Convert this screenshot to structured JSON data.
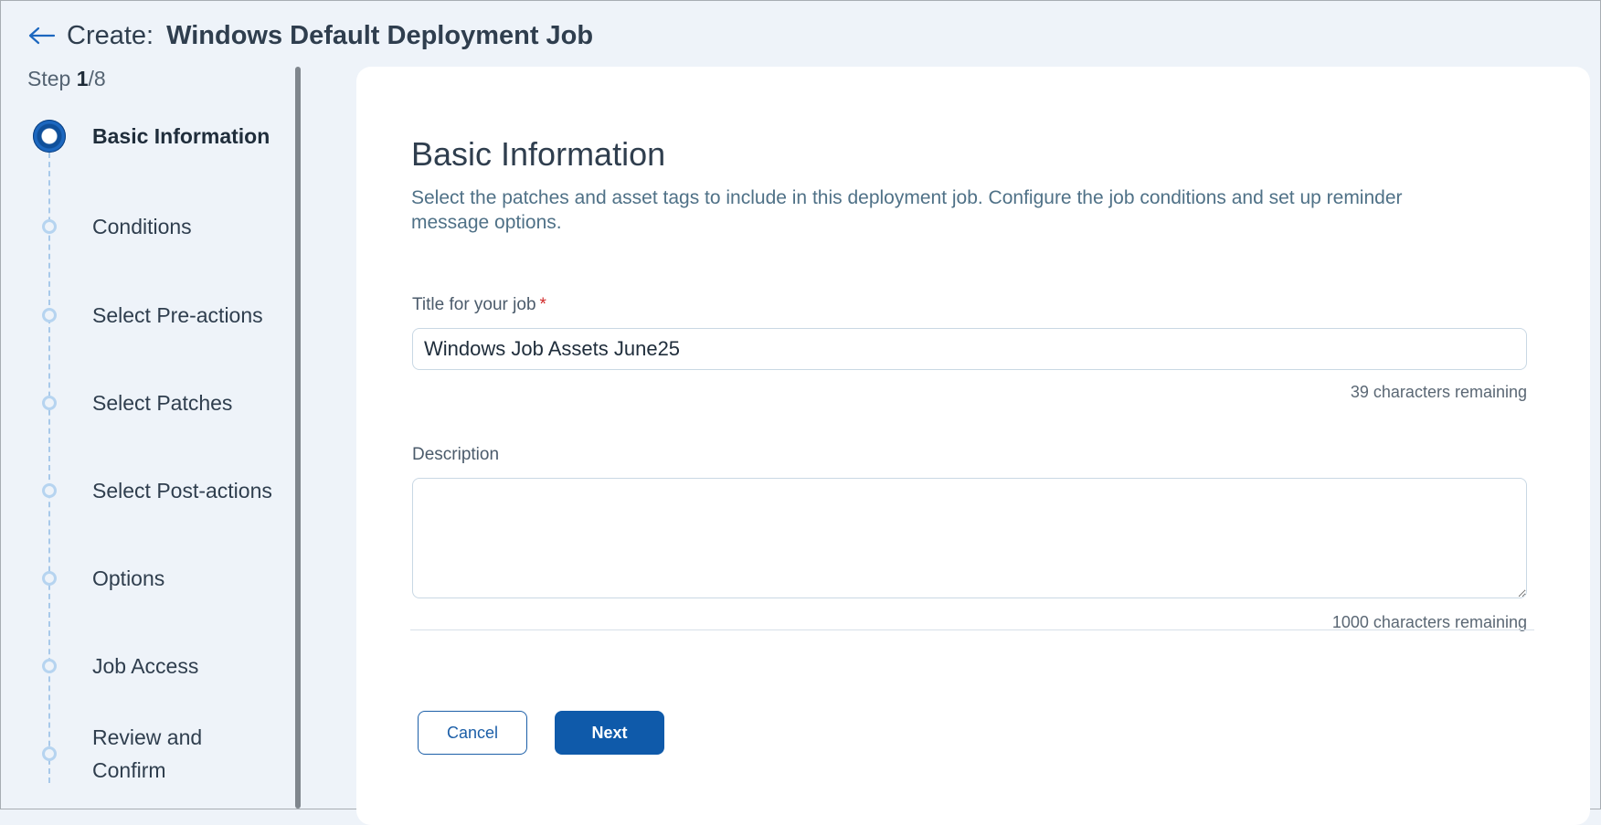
{
  "header": {
    "prefix": "Create:",
    "title": "Windows Default Deployment Job"
  },
  "step_counter": {
    "label": "Step",
    "current": "1",
    "total": "/8"
  },
  "steps": [
    {
      "label": "Basic Information",
      "active": true
    },
    {
      "label": "Conditions",
      "active": false
    },
    {
      "label": "Select Pre-actions",
      "active": false
    },
    {
      "label": "Select Patches",
      "active": false
    },
    {
      "label": "Select Post-actions",
      "active": false
    },
    {
      "label": "Options",
      "active": false
    },
    {
      "label": "Job Access",
      "active": false
    },
    {
      "label": "Review and Confirm",
      "active": false
    }
  ],
  "main": {
    "title": "Basic Information",
    "description": "Select the patches and asset tags to include in this deployment job. Configure the job conditions and set up reminder message options.",
    "job_title": {
      "label": "Title for your job",
      "required_mark": "*",
      "value": "Windows Job Assets June25",
      "remaining": "39 characters remaining"
    },
    "description_field": {
      "label": "Description",
      "value": "",
      "remaining": "1000 characters remaining"
    }
  },
  "buttons": {
    "cancel": "Cancel",
    "next": "Next"
  },
  "colors": {
    "accent": "#0f5aaa",
    "background": "#eef3f9",
    "required": "#d12a2a"
  }
}
